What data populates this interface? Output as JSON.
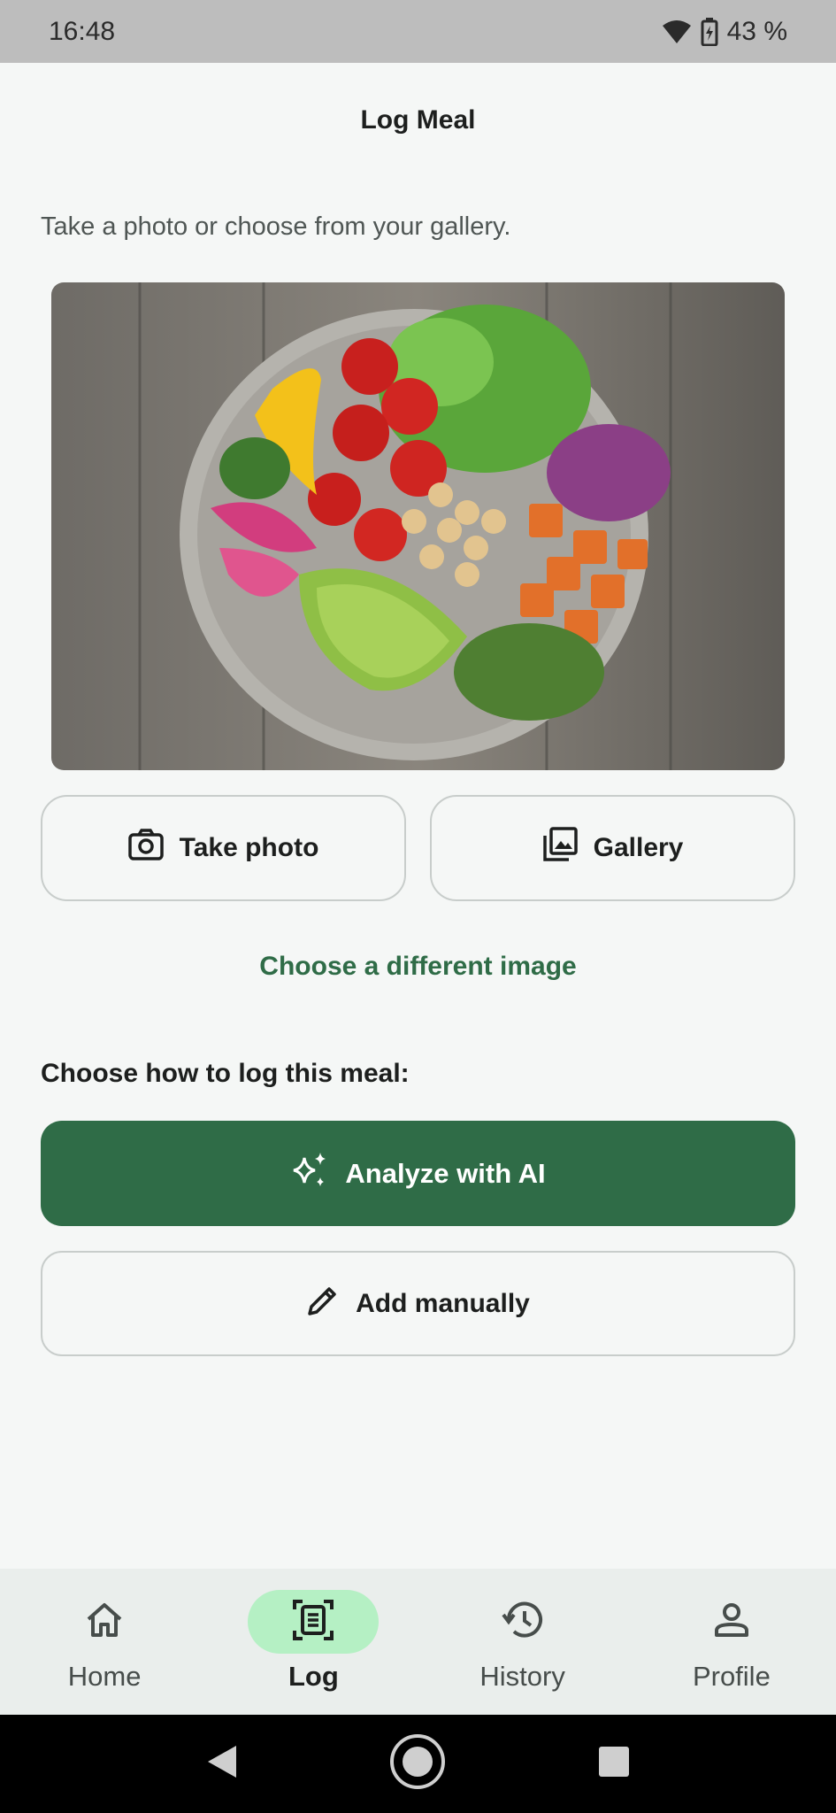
{
  "status_bar": {
    "time": "16:48",
    "battery": "43 %"
  },
  "app_bar": {
    "title": "Log Meal"
  },
  "subtitle": "Take a photo or choose from your gallery.",
  "photo_actions": {
    "take_photo": "Take photo",
    "gallery": "Gallery"
  },
  "change_image_link": "Choose a different image",
  "log_section": {
    "label": "Choose how to log this meal:",
    "analyze_ai": "Analyze with AI",
    "add_manually": "Add manually"
  },
  "bottom_nav": {
    "items": [
      {
        "label": "Home",
        "icon": "home-icon"
      },
      {
        "label": "Log",
        "icon": "log-icon",
        "active": true
      },
      {
        "label": "History",
        "icon": "history-icon"
      },
      {
        "label": "Profile",
        "icon": "profile-icon"
      }
    ]
  },
  "colors": {
    "primary": "#2f6c47",
    "active_pill": "#b5f0c4"
  }
}
